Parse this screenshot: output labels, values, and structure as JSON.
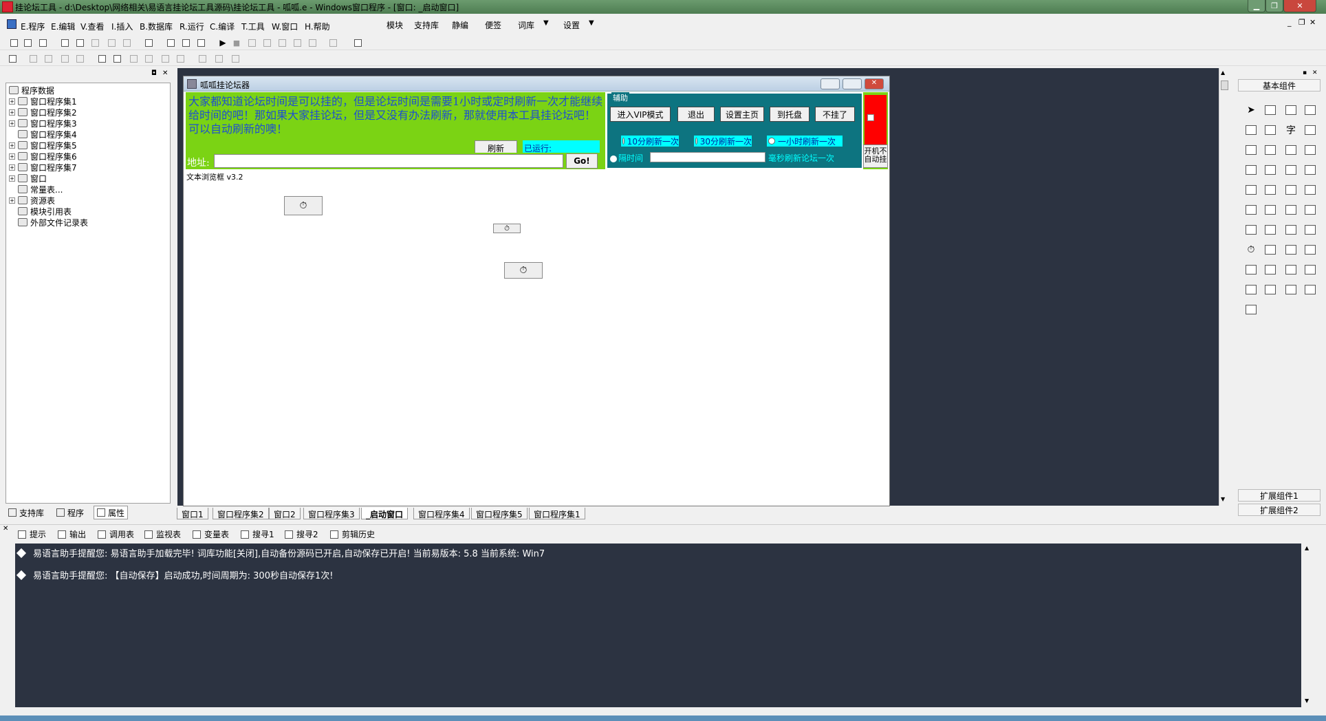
{
  "window": {
    "title": "挂论坛工具 - d:\\Desktop\\网络相关\\易语言挂论坛工具源码\\挂论坛工具 - 呱呱.e - Windows窗口程序 - [窗口: _启动窗口]"
  },
  "menu": {
    "items": [
      "E.程序",
      "E.编辑",
      "V.查看",
      "I.插入",
      "B.数据库",
      "R.运行",
      "C.编译",
      "T.工具",
      "W.窗口",
      "H.帮助"
    ],
    "extra": [
      "模块",
      "支持库",
      "静编",
      "便签",
      "词库",
      "设置"
    ]
  },
  "tree": {
    "root": "程序数据",
    "items": [
      "窗口程序集1",
      "窗口程序集2",
      "窗口程序集3",
      "窗口程序集4",
      "窗口程序集5",
      "窗口程序集6",
      "窗口程序集7",
      "窗口",
      "常量表...",
      "资源表",
      "模块引用表",
      "外部文件记录表"
    ]
  },
  "left_tabs": [
    "支持库",
    "程序",
    "属性"
  ],
  "form": {
    "title": "呱呱挂论坛器",
    "intro_text": "大家都知道论坛时间是可以挂的，但是论坛时间是需要1小时或定时刷新一次才能继续给时间的吧！那如果大家挂论坛，但是又没有办法刷新，那就使用本工具挂论坛吧！可以自动刷新的噢！",
    "refresh_label": "刷新",
    "running_label": "已运行:",
    "address_label": "地址:",
    "go_label": "Go!",
    "aux_label": "辅助",
    "buttons": [
      "进入VIP模式",
      "退出",
      "设置主页",
      "到托盘",
      "不挂了"
    ],
    "radios": [
      "10分刷新一次",
      "30分刷新一次",
      "一小时刷新一次"
    ],
    "interval_label": "隔时间",
    "interval_suffix": "毫秒刷新论坛一次",
    "autostart_label": "开机不自动挂",
    "browser_label": "文本浏览框 v3.2"
  },
  "palette": {
    "title": "基本组件",
    "ext1": "扩展组件1",
    "ext2": "扩展组件2"
  },
  "doc_tabs": [
    "窗口1",
    "窗口程序集2",
    "窗口2",
    "窗口程序集3",
    "_启动窗口",
    "窗口程序集4",
    "窗口程序集5",
    "窗口程序集1"
  ],
  "output_tabs": [
    "提示",
    "输出",
    "调用表",
    "监视表",
    "变量表",
    "搜寻1",
    "搜寻2",
    "剪辑历史"
  ],
  "output_lines": [
    "易语言助手提醒您:  易语言助手加载完毕!  词库功能[关闭],自动备份源码已开启,自动保存已开启!  当前易版本: 5.8  当前系统: Win7",
    "易语言助手提醒您: 【自动保存】启动成功,时间周期为: 300秒自动保存1次!"
  ],
  "colors": {
    "green_panel": "#7bd314",
    "cyan": "#00ffff",
    "design_bg": "#2c3341",
    "teal": "#0d7480",
    "red": "#ff0000"
  }
}
